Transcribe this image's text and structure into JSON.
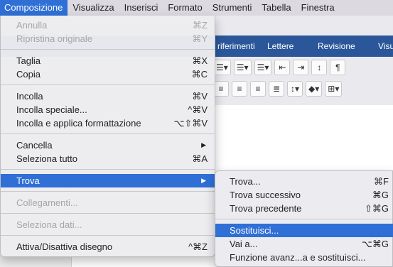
{
  "menubar": {
    "items": [
      "Composizione",
      "Visualizza",
      "Inserisci",
      "Formato",
      "Strumenti",
      "Tabella",
      "Finestra"
    ]
  },
  "ribbon": {
    "tabs": [
      "riferimenti",
      "Lettere",
      "Revisione",
      "Visu"
    ]
  },
  "edit_menu": {
    "undo": {
      "label": "Annulla",
      "shortcut": "⌘Z"
    },
    "restore": {
      "label": "Ripristina originale",
      "shortcut": "⌘Y"
    },
    "cut": {
      "label": "Taglia",
      "shortcut": "⌘X"
    },
    "copy": {
      "label": "Copia",
      "shortcut": "⌘C"
    },
    "paste": {
      "label": "Incolla",
      "shortcut": "⌘V"
    },
    "paste_special": {
      "label": "Incolla speciale...",
      "shortcut": "^⌘V"
    },
    "paste_match": {
      "label": "Incolla e applica formattazione",
      "shortcut": "⌥⇧⌘V"
    },
    "clear": {
      "label": "Cancella"
    },
    "select_all": {
      "label": "Seleziona tutto",
      "shortcut": "⌘A"
    },
    "find": {
      "label": "Trova"
    },
    "links": {
      "label": "Collegamenti..."
    },
    "select_data": {
      "label": "Seleziona dati..."
    },
    "toggle_drawing": {
      "label": "Attiva/Disattiva disegno",
      "shortcut": "^⌘Z"
    }
  },
  "find_submenu": {
    "find": {
      "label": "Trova...",
      "shortcut": "⌘F"
    },
    "find_next": {
      "label": "Trova successivo",
      "shortcut": "⌘G"
    },
    "find_prev": {
      "label": "Trova precedente",
      "shortcut": "⇧⌘G"
    },
    "replace": {
      "label": "Sostituisci..."
    },
    "goto": {
      "label": "Vai a...",
      "shortcut": "⌥⌘G"
    },
    "advanced": {
      "label": "Funzione avanz...a e sostituisci..."
    }
  }
}
